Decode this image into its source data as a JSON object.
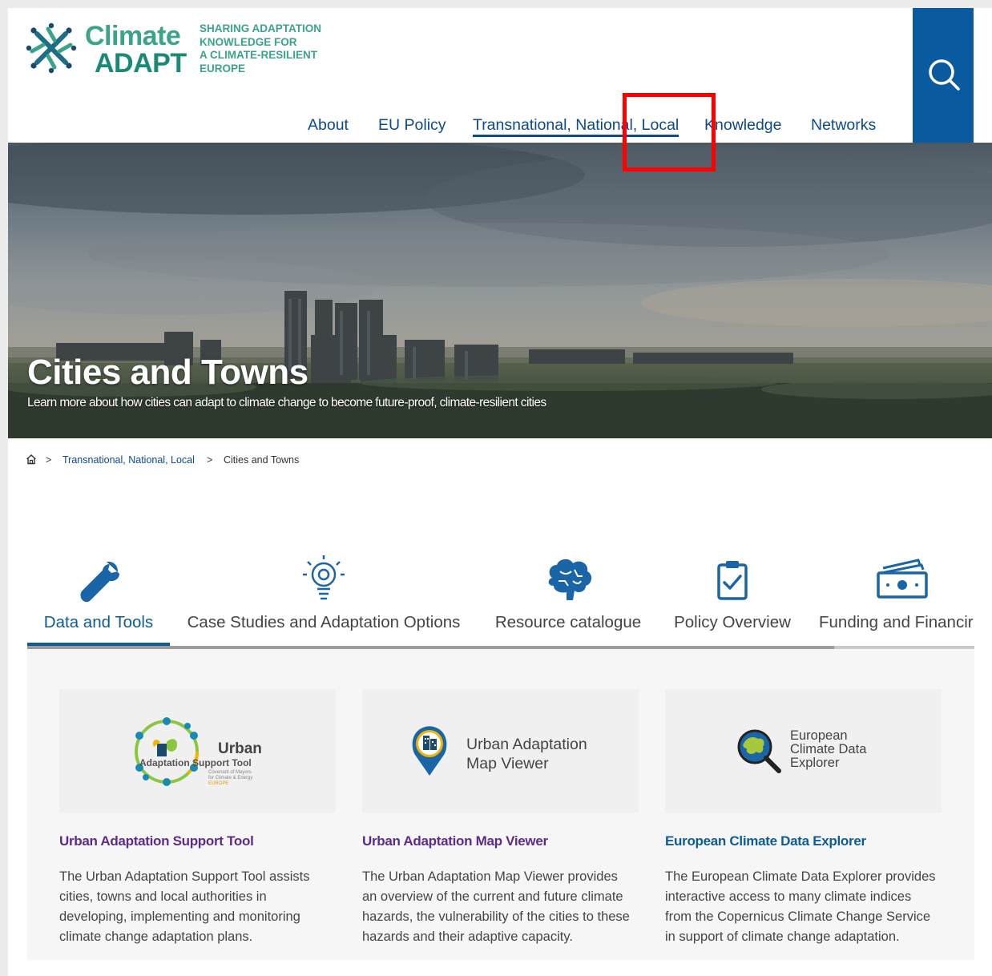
{
  "header": {
    "logo_word1": "Climate",
    "logo_word2": "ADAPT",
    "tagline_lines": [
      "SHARING ADAPTATION",
      "KNOWLEDGE FOR",
      "A CLIMATE-RESILIENT",
      "EUROPE"
    ],
    "nav": [
      {
        "label": "About"
      },
      {
        "label": "EU Policy"
      },
      {
        "label": "Transnational, National, Local",
        "active": true
      },
      {
        "label": "Knowledge"
      },
      {
        "label": "Networks"
      }
    ],
    "search_icon": "search-icon"
  },
  "hero": {
    "title": "Cities and Towns",
    "subtitle": "Learn more about how cities can adapt to climate change to become future-proof, climate-resilient cities"
  },
  "breadcrumb": {
    "home_icon": "home-icon",
    "items": [
      "Transnational, National, Local",
      "Cities and Towns"
    ],
    "separator": ">"
  },
  "tabs": [
    {
      "label": "Data and Tools",
      "icon": "wrench-icon",
      "active": true
    },
    {
      "label": "Case Studies and Adaptation Options",
      "icon": "lightbulb-icon"
    },
    {
      "label": "Resource catalogue",
      "icon": "brain-icon"
    },
    {
      "label": "Policy Overview",
      "icon": "clipboard-check-icon"
    },
    {
      "label": "Funding and Financir",
      "icon": "money-icon"
    }
  ],
  "cards": [
    {
      "title": "Urban Adaptation Support Tool",
      "image_text": [
        "Urban",
        "Adaptation Support Tool",
        "Covenant of Mayors",
        "for Climate & Energy",
        "EUROPE"
      ],
      "desc_lines": [
        "The Urban Adaptation Support Tool assists",
        "cities, towns and local authorities in",
        "developing, implementing and monitoring",
        "climate change adaptation plans."
      ]
    },
    {
      "title": "Urban Adaptation Map Viewer",
      "image_text": [
        "Urban Adaptation",
        "Map Viewer"
      ],
      "desc_lines": [
        "The Urban Adaptation Map Viewer provides",
        "an overview of the current and future climate",
        "hazards, the vulnerability of the cities to these",
        "hazards and their adaptive capacity."
      ]
    },
    {
      "title": "European Climate Data Explorer",
      "image_text": [
        "European",
        "Climate Data",
        "Explorer"
      ],
      "desc_lines": [
        "The European Climate Data Explorer provides",
        "interactive access to many climate indices",
        "from the Copernicus Climate Change Service",
        "in support of climate change adaptation."
      ]
    }
  ],
  "colors": {
    "brand_green": "#3aa38a",
    "nav_blue": "#0d4a8a",
    "search_bg": "#0a5aa0",
    "highlight": "#ff0000",
    "card_title_purple": "#5b2c8c",
    "card_title_blue": "#0d5c96"
  }
}
